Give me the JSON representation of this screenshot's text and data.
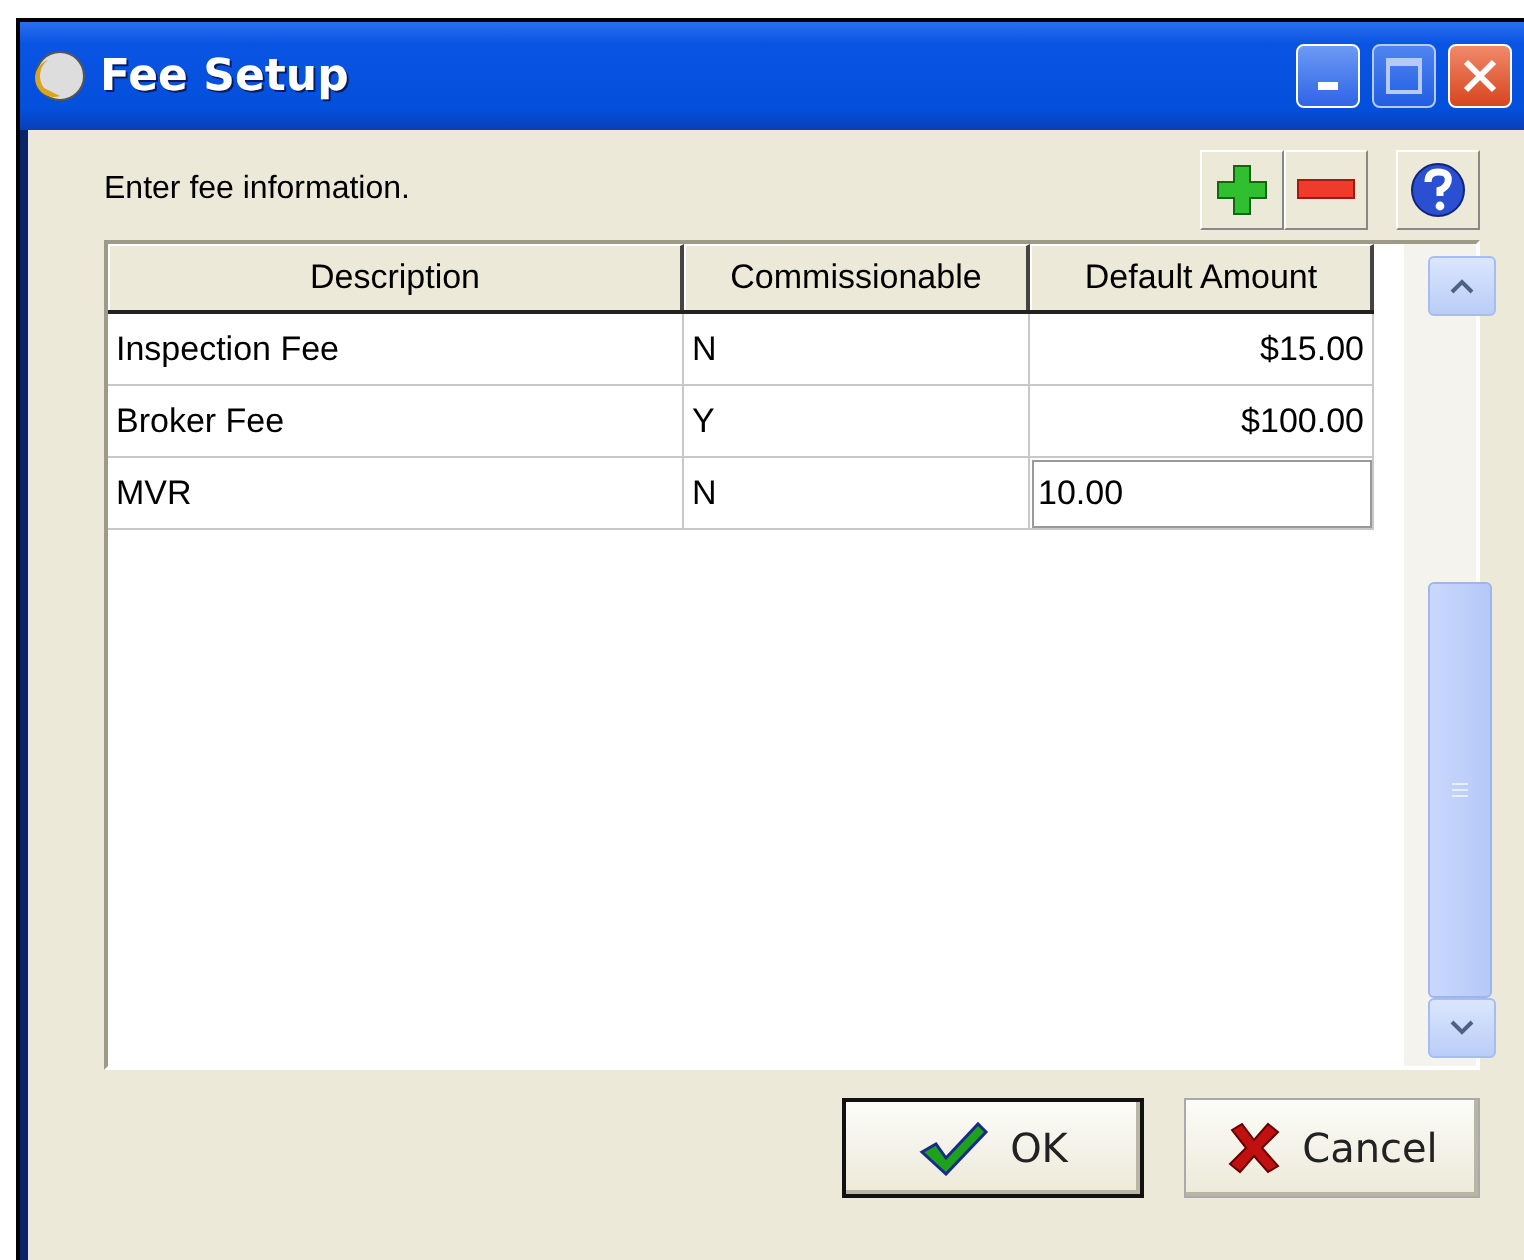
{
  "window": {
    "title": "Fee Setup"
  },
  "instruction": "Enter fee information.",
  "table": {
    "columns": [
      "Description",
      "Commissionable",
      "Default Amount"
    ],
    "rows": [
      {
        "cells": [
          "Inspection Fee",
          "N",
          "$15.00"
        ],
        "editing": false
      },
      {
        "cells": [
          "Broker Fee",
          "Y",
          "$100.00"
        ],
        "editing": false
      },
      {
        "cells": [
          "MVR",
          "N",
          "10.00"
        ],
        "editing": true
      }
    ]
  },
  "buttons": [
    {
      "kind": "ok",
      "label": "OK",
      "default": true
    },
    {
      "kind": "cancel",
      "label": "Cancel",
      "default": false
    }
  ]
}
